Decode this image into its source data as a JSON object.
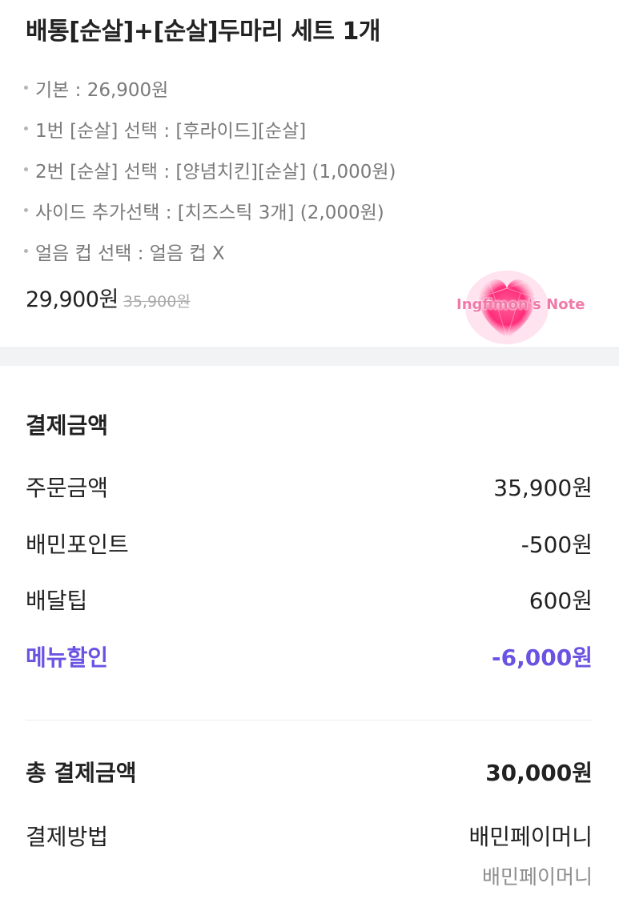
{
  "order": {
    "title": "배통[순살]+[순살]두마리 세트 1개",
    "options": [
      "기본 : 26,900원",
      "1번 [순살] 선택 : [후라이드][순살]",
      "2번 [순살] 선택 : [양념치킨][순살] (1,000원)",
      "사이드 추가선택 : [치즈스틱 3개] (2,000원)",
      "얼음 컵 선택 : 얼음 컵 X"
    ],
    "price_current": "29,900원",
    "price_original": "35,900원"
  },
  "watermark": {
    "text": "Ingfimon's Note",
    "color": "#ff2d7a"
  },
  "payment": {
    "section_title": "결제금액",
    "rows": [
      {
        "label": "주문금액",
        "value": "35,900원"
      },
      {
        "label": "배민포인트",
        "value": "-500원"
      },
      {
        "label": "배달팁",
        "value": "600원"
      },
      {
        "label": "메뉴할인",
        "value": "-6,000원"
      }
    ],
    "total": {
      "label": "총 결제금액",
      "value": "30,000원"
    },
    "method": {
      "label": "결제방법",
      "value": "배민페이머니",
      "sub_value": "배민페이머니"
    }
  },
  "colors": {
    "discount": "#6a53e3",
    "text": "#222222",
    "muted": "#7a7a7a",
    "section_gap": "#f2f3f5"
  }
}
